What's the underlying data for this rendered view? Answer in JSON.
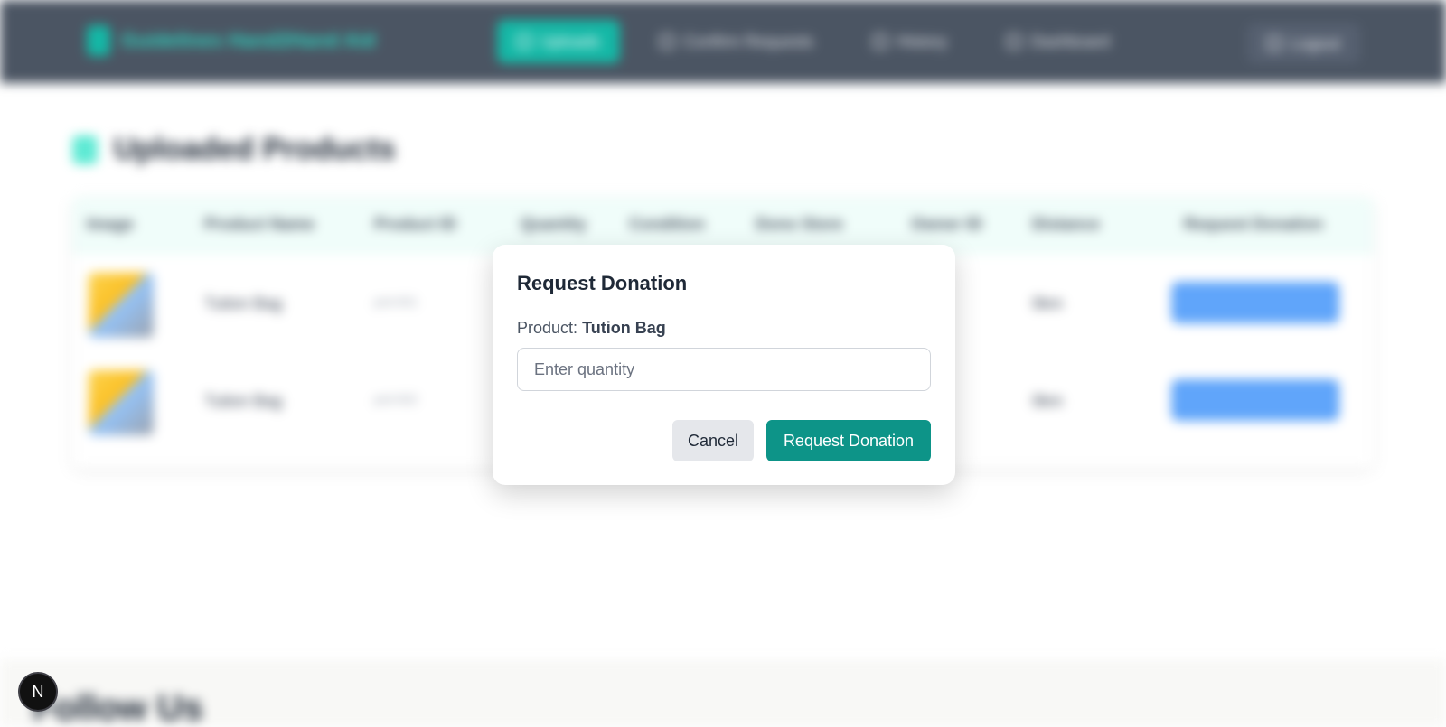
{
  "navbar": {
    "brand": "Guidelines Hand2Hand Aid",
    "links": [
      {
        "label": "Uploads"
      },
      {
        "label": "Confirm Requests"
      },
      {
        "label": "History"
      },
      {
        "label": "Dashboard"
      }
    ],
    "login_label": "Logout"
  },
  "page": {
    "title": "Uploaded Products"
  },
  "table": {
    "headers": [
      "Image",
      "Product Name",
      "Product ID",
      "Quantity",
      "Condition",
      "Dono Store",
      "Owner ID",
      "Distance",
      "Request Donation"
    ],
    "rows": [
      {
        "name": "Tution Bag",
        "id": "prd-001",
        "distance": "0km"
      },
      {
        "name": "Tution Bag",
        "id": "prd-002",
        "distance": "0km"
      }
    ]
  },
  "footer": {
    "heading": "Follow Us"
  },
  "modal": {
    "title": "Request Donation",
    "product_label": "Product:",
    "product_name": "Tution Bag",
    "quantity_placeholder": "Enter quantity",
    "cancel_label": "Cancel",
    "submit_label": "Request Donation"
  },
  "dev_badge": "N",
  "colors": {
    "accent": "#0d9488",
    "nav_bg": "#4b5563",
    "row_button": "#60a5fa"
  }
}
